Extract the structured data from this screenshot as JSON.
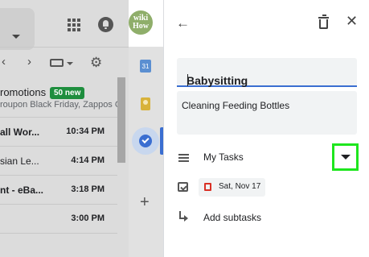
{
  "gmail": {
    "promotions": {
      "title": "romotions",
      "badge": "50 new",
      "sub": "roupon Black Friday, Zappos C"
    },
    "rows": [
      {
        "subject": "all Wor...",
        "time": "10:34 PM",
        "bold": true
      },
      {
        "subject": "sian Le...",
        "time": "4:14 PM",
        "bold": false
      },
      {
        "subject": "nt - eBa...",
        "time": "3:18 PM",
        "bold": true
      },
      {
        "subject": "",
        "time": "3:00 PM",
        "bold": true
      }
    ],
    "nav": {
      "prev": "‹",
      "next": "›"
    },
    "avatar": {
      "line1": "wiki",
      "line2": "How"
    }
  },
  "side_strip": {
    "calendar_day": "31",
    "add_glyph": "+"
  },
  "task": {
    "back_glyph": "←",
    "close_glyph": "✕",
    "title": "Babysitting",
    "details": "Cleaning Feeding Bottles",
    "list_name": "My Tasks",
    "date": "Sat, Nov 17",
    "add_subtasks": "Add subtasks"
  },
  "colors": {
    "accent_blue": "#3a6ed1",
    "badge_green": "#1e8e3e",
    "highlight_green": "#1ee61e",
    "date_red": "#d93025"
  }
}
